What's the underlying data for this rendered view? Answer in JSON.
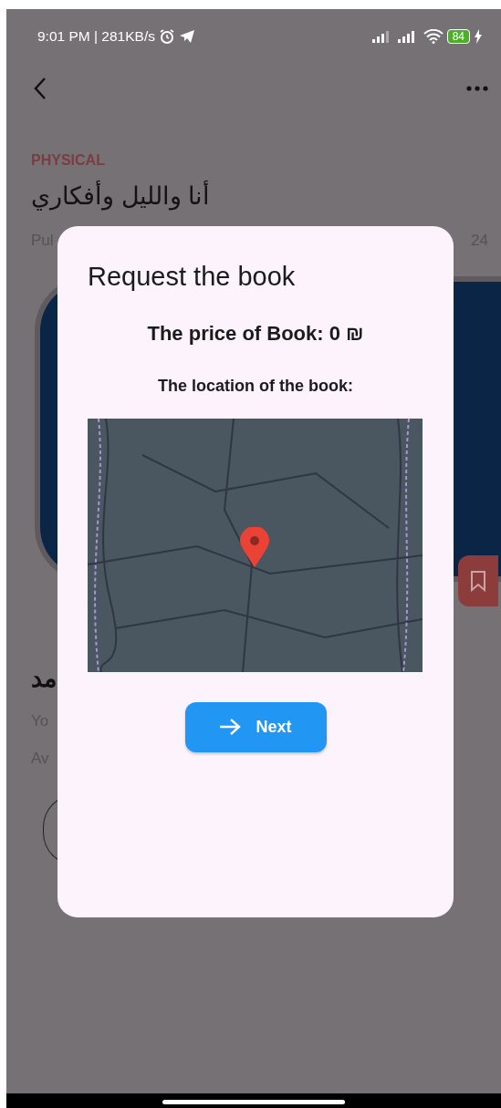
{
  "status_bar": {
    "time": "9:01 PM | 281KB/s",
    "battery": "84"
  },
  "background": {
    "category": "PHYSICAL",
    "title": "أنا والليل وأفكاري",
    "published_fragment": "Pul",
    "date_fragment": "24",
    "section_title_fragment": "مد",
    "line_1_fragment": "Yo",
    "line_2_fragment": "Av"
  },
  "dialog": {
    "title": "Request the book",
    "price": "The price of Book: 0 ₪",
    "location_label": "The location of the book:",
    "button": "Next"
  }
}
